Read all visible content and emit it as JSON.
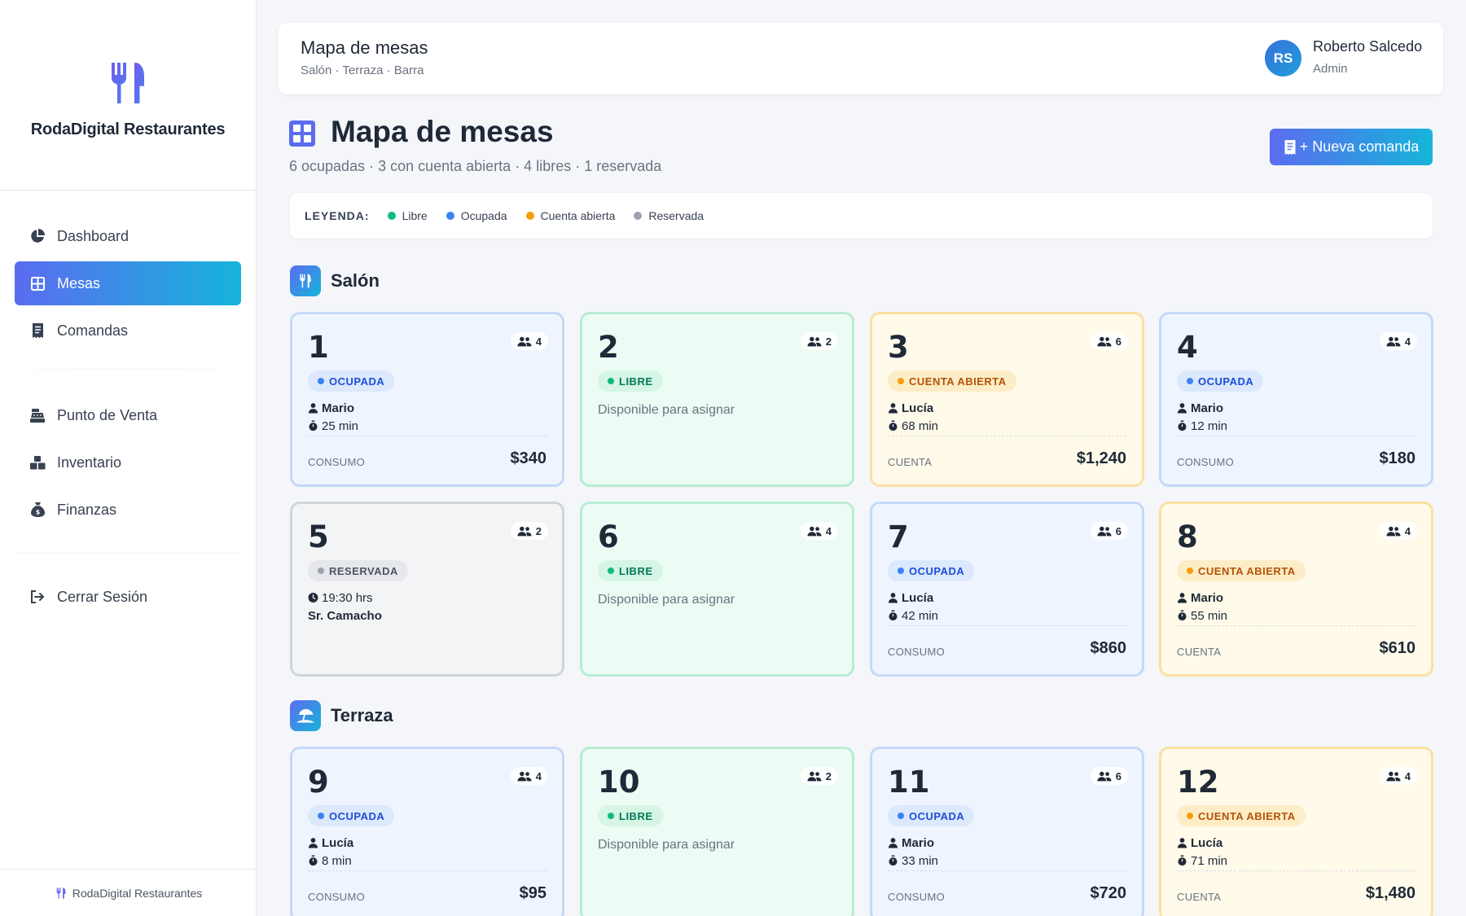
{
  "app": {
    "name": "RodaDigital Restaurantes"
  },
  "colors": {
    "accent_start": "#5b6cf0",
    "accent_end": "#16b4da",
    "libre": "#10b981",
    "ocupada": "#3b82f6",
    "cuenta": "#f59e0b",
    "reservada": "#9ca3af"
  },
  "sidebar": {
    "items": [
      {
        "label": "Dashboard",
        "icon": "pie-chart-icon"
      },
      {
        "label": "Mesas",
        "icon": "grid-icon",
        "active": true
      },
      {
        "label": "Comandas",
        "icon": "receipt-icon"
      },
      {
        "label": "Punto de Venta",
        "icon": "cash-register-icon"
      },
      {
        "label": "Inventario",
        "icon": "boxes-icon"
      },
      {
        "label": "Finanzas",
        "icon": "money-bag-icon"
      }
    ],
    "logout": "Cerrar Sesión",
    "footer": "RodaDigital Restaurantes"
  },
  "topbar": {
    "title": "Mapa de mesas",
    "subtitle": "Salón · Terraza · Barra",
    "user": {
      "initials": "RS",
      "name": "Roberto Salcedo",
      "role": "Admin"
    }
  },
  "page": {
    "title": "Mapa de mesas",
    "summary": "6 ocupadas · 3 con cuenta abierta · 4 libres · 1 reservada",
    "new_button": "+ Nueva comanda"
  },
  "legend": {
    "label": "LEYENDA:",
    "items": [
      "Libre",
      "Ocupada",
      "Cuenta abierta",
      "Reservada"
    ]
  },
  "sections": [
    {
      "title": "Salón",
      "icon": "utensils-icon",
      "tables": [
        {
          "number": "1",
          "seats": "4",
          "status": "OCUPADA",
          "waiter": "Mario",
          "time": "25 min",
          "foot_label": "CONSUMO",
          "amount": "$340"
        },
        {
          "number": "2",
          "seats": "2",
          "status": "LIBRE",
          "note": "Disponible para asignar"
        },
        {
          "number": "3",
          "seats": "6",
          "status": "CUENTA ABIERTA",
          "waiter": "Lucía",
          "time": "68 min",
          "foot_label": "CUENTA",
          "amount": "$1,240"
        },
        {
          "number": "4",
          "seats": "4",
          "status": "OCUPADA",
          "waiter": "Mario",
          "time": "12 min",
          "foot_label": "CONSUMO",
          "amount": "$180"
        },
        {
          "number": "5",
          "seats": "2",
          "status": "RESERVADA",
          "time": "19:30 hrs",
          "guest": "Sr. Camacho"
        },
        {
          "number": "6",
          "seats": "4",
          "status": "LIBRE",
          "note": "Disponible para asignar"
        },
        {
          "number": "7",
          "seats": "6",
          "status": "OCUPADA",
          "waiter": "Lucía",
          "time": "42 min",
          "foot_label": "CONSUMO",
          "amount": "$860"
        },
        {
          "number": "8",
          "seats": "4",
          "status": "CUENTA ABIERTA",
          "waiter": "Mario",
          "time": "55 min",
          "foot_label": "CUENTA",
          "amount": "$610"
        }
      ]
    },
    {
      "title": "Terraza",
      "icon": "umbrella-beach-icon",
      "tables": [
        {
          "number": "9",
          "seats": "4",
          "status": "OCUPADA",
          "waiter": "Lucía",
          "time": "8 min",
          "foot_label": "CONSUMO",
          "amount": "$95"
        },
        {
          "number": "10",
          "seats": "2",
          "status": "LIBRE",
          "note": "Disponible para asignar"
        },
        {
          "number": "11",
          "seats": "6",
          "status": "OCUPADA",
          "waiter": "Mario",
          "time": "33 min",
          "foot_label": "CONSUMO",
          "amount": "$720"
        },
        {
          "number": "12",
          "seats": "4",
          "status": "CUENTA ABIERTA",
          "waiter": "Lucía",
          "time": "71 min",
          "foot_label": "CUENTA",
          "amount": "$1,480"
        }
      ]
    }
  ]
}
